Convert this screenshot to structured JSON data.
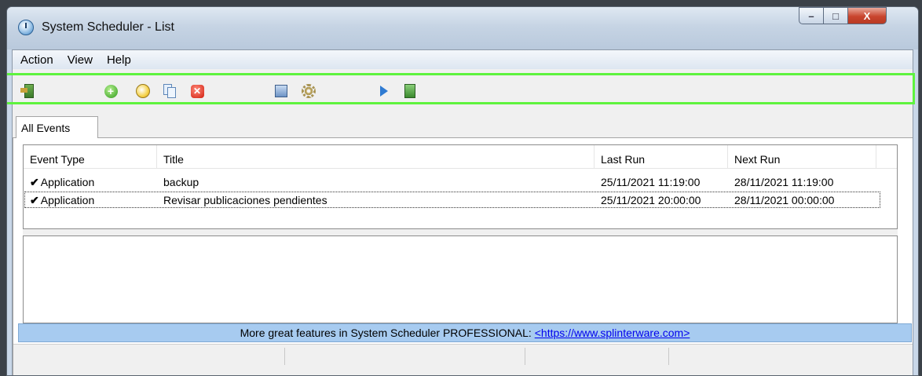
{
  "window": {
    "title": "System Scheduler - List",
    "minimize_glyph": "–",
    "maximize_glyph": "□",
    "close_glyph": "X"
  },
  "menu": {
    "items": [
      "Action",
      "View",
      "Help"
    ]
  },
  "toolbar": {
    "icons": [
      "exit-icon",
      "add-event-icon",
      "edit-event-icon",
      "copy-event-icon",
      "delete-event-icon",
      "event-log-icon",
      "settings-icon",
      "run-icon",
      "export-icon"
    ]
  },
  "tabs": [
    {
      "label": "All Events",
      "active": true
    }
  ],
  "table": {
    "columns": [
      "Event Type",
      "Title",
      "Last Run",
      "Next Run"
    ],
    "rows": [
      {
        "event_type": "Application",
        "title": "backup",
        "last_run": "25/11/2021 11:19:00",
        "next_run": "28/11/2021 11:19:00",
        "checked": true
      },
      {
        "event_type": "Application",
        "title": "Revisar publicaciones pendientes",
        "last_run": "25/11/2021 20:00:00",
        "next_run": "28/11/2021 00:00:00",
        "checked": true
      }
    ],
    "check_glyph": "✔"
  },
  "promo": {
    "text": "More great features in System Scheduler PROFESSIONAL:",
    "link": "<https://www.splinterware.com>"
  },
  "colors": {
    "highlight": "#5ef33e",
    "promo_bg": "#a7cbf0",
    "close_button": "#c9452e"
  }
}
